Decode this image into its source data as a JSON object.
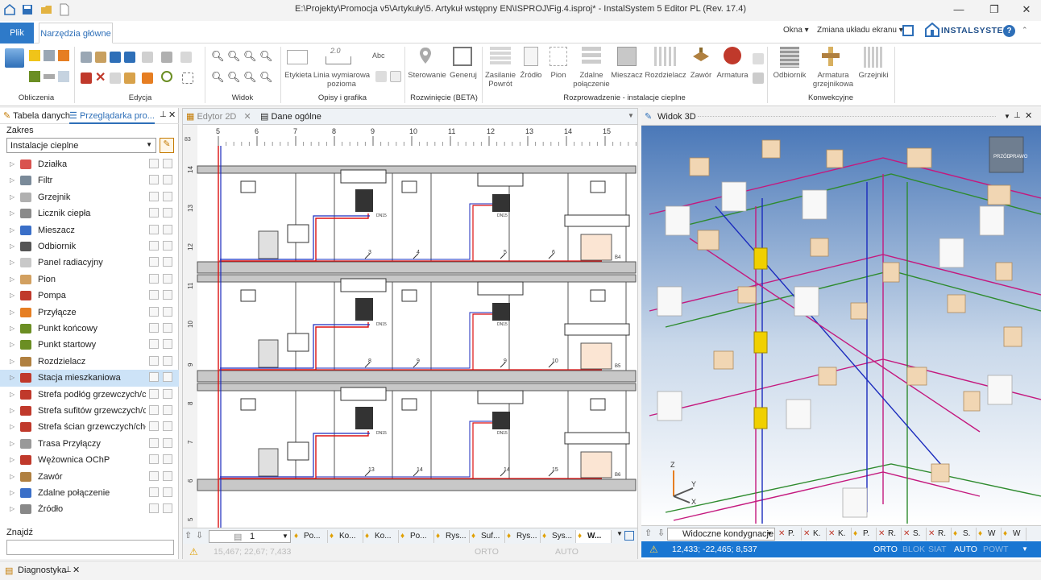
{
  "window": {
    "title": "E:\\Projekty\\Promocja v5\\Artykuły\\5. Artykuł wstępny EN\\ISPROJ\\Fig.4.isproj* - InstalSystem 5 Editor PL (Rev. 17.4)",
    "controls": {
      "minimize": "—",
      "restore": "❐",
      "close": "✕"
    }
  },
  "ribbon_tabs": {
    "file": "Plik",
    "main": "Narzędzia główne"
  },
  "ribbon_top_right": {
    "windows": "Okna",
    "layout": "Zmiana układu ekranu",
    "brand": "INSTALSYSTEM",
    "help": "?"
  },
  "ribbon_groups": {
    "calc": "Obliczenia",
    "edit": "Edycja",
    "view": "Widok",
    "desc": "Opisy i grafika",
    "dev": "Rozwinięcie  (BETA)",
    "routing": "Rozprowadzenie - instalacje cieplne",
    "convective": "Konwekcyjne"
  },
  "ribbon_buttons": {
    "label": "Etykieta",
    "dimline": "Linia wymiarowa\npozioma",
    "control": "Sterowanie",
    "generate": "Generuj",
    "supply": "Zasilanie\nPowrót",
    "source": "Źródło",
    "riser": "Pion",
    "remote": "Zdalne\npołączenie",
    "mixer": "Mieszacz",
    "distributor": "Rozdzielacz",
    "valve": "Zawór",
    "fittings": "Armatura",
    "receiver": "Odbiornik",
    "radfit": "Armatura\ngrzejnikowa",
    "radiator": "Grzejniki",
    "dim_value": "2.0",
    "text_icon": "Abc"
  },
  "left_panel": {
    "tabs": [
      "Tabela danych",
      "Przeglądarka pro..."
    ],
    "scope_label": "Zakres",
    "scope_value": "Instalacje cieplne",
    "find_label": "Znajdź",
    "items": [
      {
        "label": "Działka",
        "color": "#d9534f"
      },
      {
        "label": "Filtr",
        "color": "#7a8a99"
      },
      {
        "label": "Grzejnik",
        "color": "#b0b0b0"
      },
      {
        "label": "Licznik ciepła",
        "color": "#8a8a8a"
      },
      {
        "label": "Mieszacz",
        "color": "#3a6fc8"
      },
      {
        "label": "Odbiornik",
        "color": "#555555"
      },
      {
        "label": "Panel radiacyjny",
        "color": "#c8c8c8"
      },
      {
        "label": "Pion",
        "color": "#d2a060"
      },
      {
        "label": "Pompa",
        "color": "#c0392b"
      },
      {
        "label": "Przyłącze",
        "color": "#e67e22"
      },
      {
        "label": "Punkt końcowy",
        "color": "#6b8e23"
      },
      {
        "label": "Punkt startowy",
        "color": "#6b8e23"
      },
      {
        "label": "Rozdzielacz",
        "color": "#b08040"
      },
      {
        "label": "Stacja mieszkaniowa",
        "color": "#c0392b"
      },
      {
        "label": "Strefa podłóg grzewczych/chł",
        "color": "#c0392b"
      },
      {
        "label": "Strefa sufitów grzewczych/chł",
        "color": "#c0392b"
      },
      {
        "label": "Strefa ścian grzewczych/chłoc",
        "color": "#c0392b"
      },
      {
        "label": "Trasa Przyłączy",
        "color": "#999999"
      },
      {
        "label": "Wężownica OChP",
        "color": "#c0392b"
      },
      {
        "label": "Zawór",
        "color": "#b08040"
      },
      {
        "label": "Zdalne połączenie",
        "color": "#3a6fc8"
      },
      {
        "label": "Źródło",
        "color": "#888888"
      }
    ],
    "selected_index": 13
  },
  "editor": {
    "tabs": [
      "Edytor 2D",
      "Dane ogólne"
    ],
    "ruler_x": [
      "5",
      "6",
      "7",
      "8",
      "9",
      "10",
      "11",
      "12",
      "13",
      "14",
      "15"
    ],
    "ruler_y": [
      "14",
      "13",
      "12",
      "11",
      "10",
      "9",
      "8",
      "7",
      "6",
      "5"
    ],
    "ruler_corner": "83",
    "page_value": "1",
    "bottom_tabs": [
      "Po...",
      "Ko...",
      "Ko...",
      "Po...",
      "Rys...",
      "Suf...",
      "Rys...",
      "Sys...",
      "W..."
    ],
    "status_coords": "15,467; 22,67; 7,433",
    "status_flags": [
      "ORTO",
      "AUTO"
    ],
    "floors": [
      {
        "marks": [
          "3",
          "4",
          "5",
          "6"
        ],
        "end": "B4"
      },
      {
        "marks": [
          "8",
          "9",
          "9",
          "10"
        ],
        "end": "B5"
      },
      {
        "marks": [
          "13",
          "14",
          "14",
          "15"
        ],
        "end": "B6"
      }
    ],
    "dn_label": "DN15"
  },
  "view3d": {
    "title": "Widok 3D",
    "cube_labels": [
      "PRZÓD",
      "PRAWO"
    ],
    "axes": {
      "z": "Z",
      "y": "Y",
      "x": "X"
    },
    "storeys": "Widoczne kondygnacje",
    "bottom_tabs": [
      "P.",
      "K.",
      "K.",
      "P.",
      "R.",
      "S.",
      "R.",
      "S.",
      "W",
      "W"
    ],
    "coords": "12,433; -22,465; 8,537",
    "flags": [
      "ORTO",
      "BLOK",
      "SIAT",
      "AUTO",
      "POWT"
    ]
  },
  "bottom_panel": {
    "label": "Diagnostyka"
  }
}
